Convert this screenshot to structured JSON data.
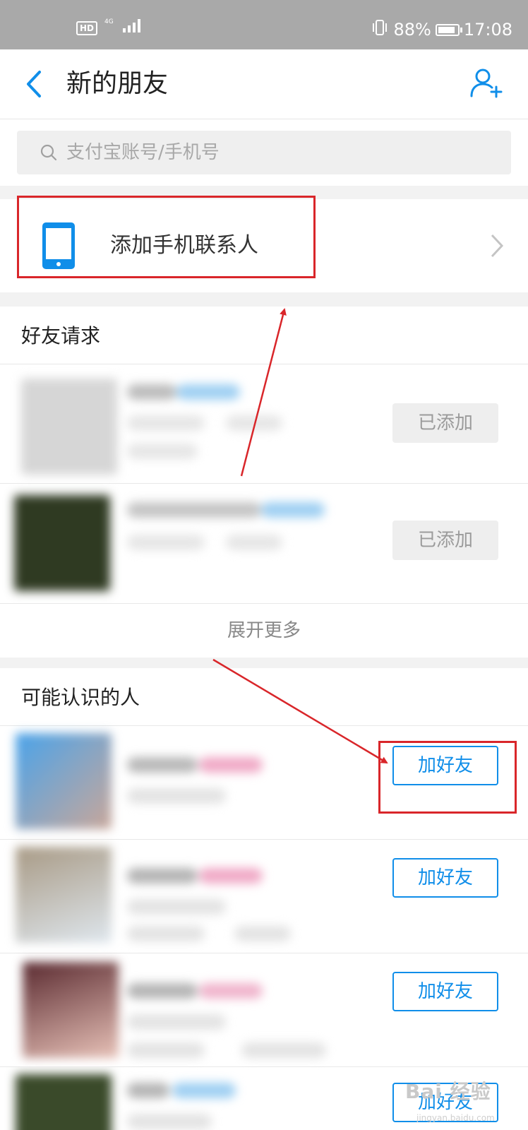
{
  "status_bar": {
    "hd_label": "HD",
    "network": "4G",
    "battery": "88%",
    "battery_level": 0.88,
    "time": "17:08"
  },
  "nav": {
    "title": "新的朋友",
    "back_icon": "chevron-left-icon",
    "add_icon": "add-user-icon"
  },
  "search": {
    "placeholder": "支付宝账号/手机号",
    "value": ""
  },
  "add_contacts": {
    "label": "添加手机联系人",
    "icon": "phone-icon"
  },
  "friend_requests": {
    "title": "好友请求",
    "items": [
      {
        "status_label": "已添加"
      },
      {
        "status_label": "已添加"
      }
    ],
    "expand_label": "展开更多"
  },
  "people_you_may_know": {
    "title": "可能认识的人",
    "items": [
      {
        "button_label": "加好友"
      },
      {
        "button_label": "加好友"
      },
      {
        "button_label": "加好友"
      },
      {
        "button_label": "加好友"
      }
    ]
  },
  "watermark": {
    "text": "Bai 经验",
    "sub": "jingyan.baidu.com"
  },
  "colors": {
    "accent": "#108ee9",
    "annotation": "#d9262a",
    "status_bar": "#a9a9a9"
  }
}
